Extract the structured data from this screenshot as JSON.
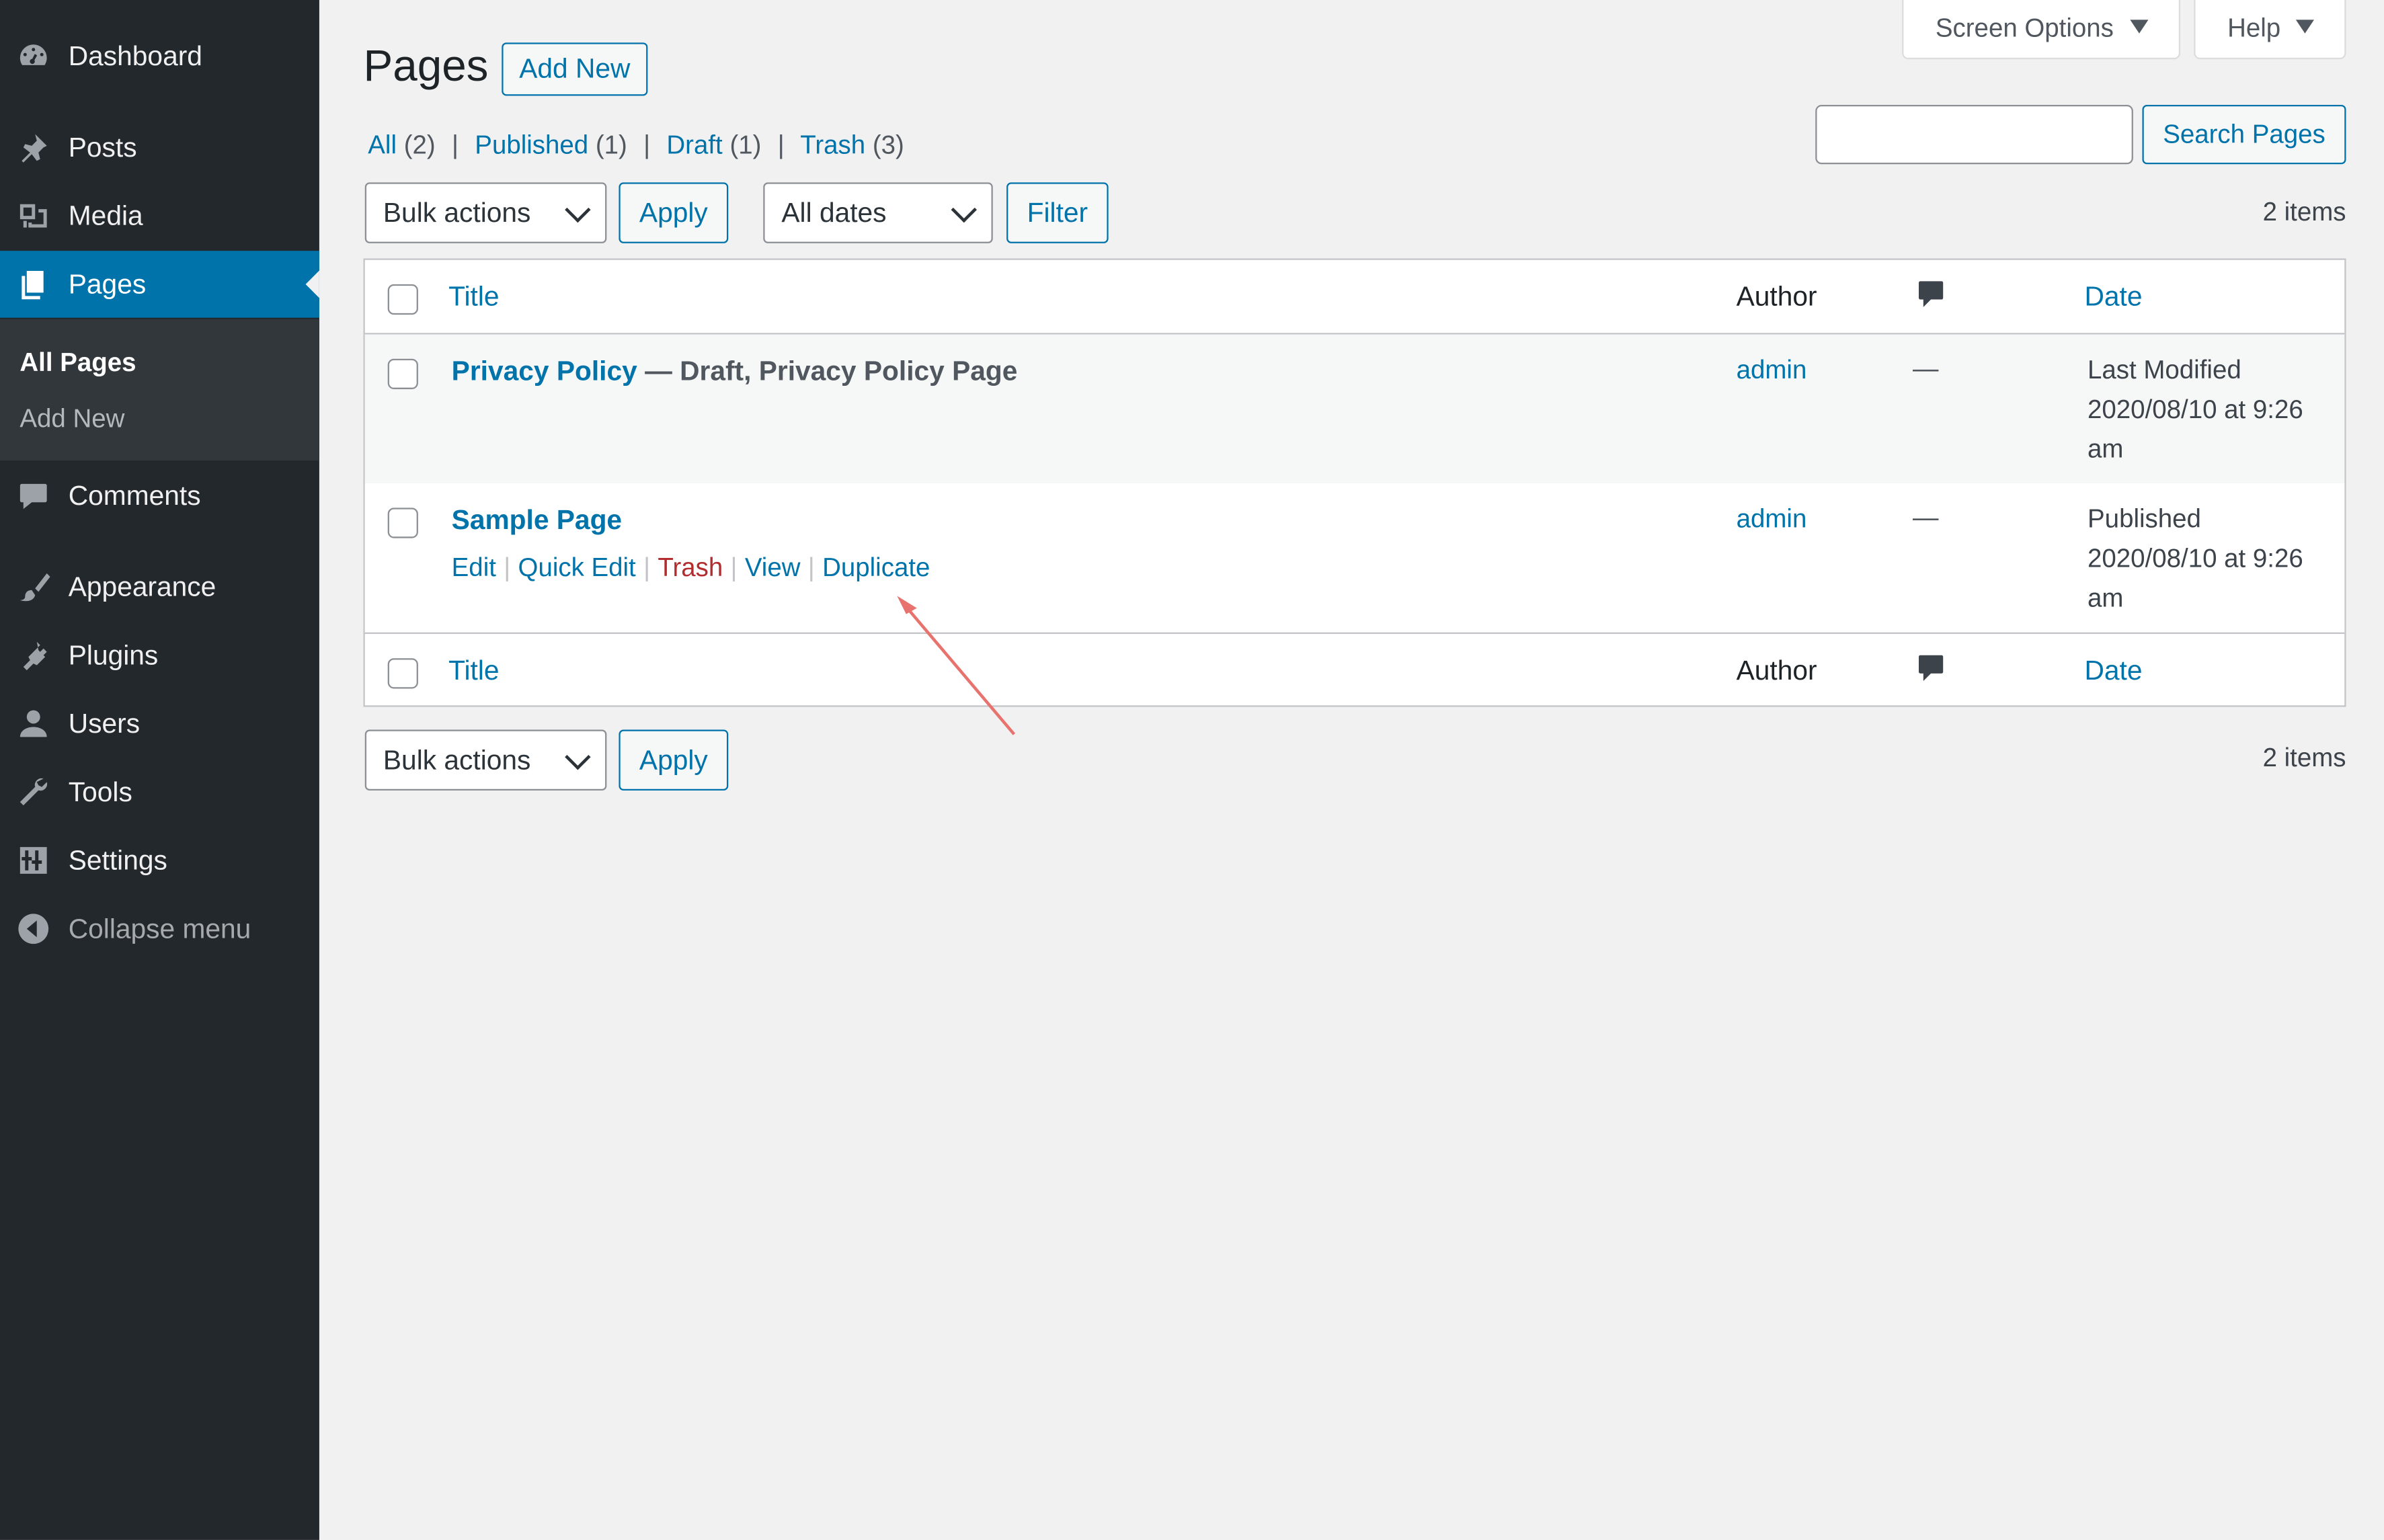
{
  "sidebar": {
    "items": [
      {
        "id": "dashboard",
        "label": "Dashboard",
        "icon": "dashboard-icon"
      },
      {
        "id": "posts",
        "label": "Posts",
        "icon": "pushpin-icon"
      },
      {
        "id": "media",
        "label": "Media",
        "icon": "media-icon"
      },
      {
        "id": "pages",
        "label": "Pages",
        "icon": "pages-icon"
      },
      {
        "id": "comments",
        "label": "Comments",
        "icon": "comment-icon"
      },
      {
        "id": "appearance",
        "label": "Appearance",
        "icon": "paintbrush-icon"
      },
      {
        "id": "plugins",
        "label": "Plugins",
        "icon": "plugin-icon"
      },
      {
        "id": "users",
        "label": "Users",
        "icon": "user-icon"
      },
      {
        "id": "tools",
        "label": "Tools",
        "icon": "wrench-icon"
      },
      {
        "id": "settings",
        "label": "Settings",
        "icon": "sliders-icon"
      },
      {
        "id": "collapse",
        "label": "Collapse menu",
        "icon": "collapse-arrow-icon"
      }
    ],
    "submenu": [
      {
        "label": "All Pages",
        "active": true
      },
      {
        "label": "Add New",
        "active": false
      }
    ]
  },
  "header": {
    "title": "Pages",
    "add_new": "Add New",
    "screen_options": "Screen Options",
    "help": "Help"
  },
  "views": [
    {
      "label": "All",
      "count": "(2)"
    },
    {
      "label": "Published",
      "count": "(1)"
    },
    {
      "label": "Draft",
      "count": "(1)"
    },
    {
      "label": "Trash",
      "count": "(3)"
    }
  ],
  "search": {
    "value": "",
    "button": "Search Pages"
  },
  "tablenav_top": {
    "bulk_actions": "Bulk actions",
    "apply": "Apply",
    "dates": "All dates",
    "filter": "Filter",
    "count": "2 items"
  },
  "tablenav_bottom": {
    "bulk_actions": "Bulk actions",
    "apply": "Apply",
    "count": "2 items"
  },
  "columns": {
    "title": "Title",
    "author": "Author",
    "comments_icon": "comment-bubble-icon",
    "date": "Date"
  },
  "rows": [
    {
      "title": "Privacy Policy",
      "state": " — Draft, Privacy Policy Page",
      "author": "admin",
      "comments": "—",
      "date_status": "Last Modified",
      "date_value": "2020/08/10 at 9:26",
      "date_suffix": "am"
    },
    {
      "title": "Sample Page",
      "state": "",
      "author": "admin",
      "comments": "—",
      "date_status": "Published",
      "date_value": "2020/08/10 at 9:26",
      "date_suffix": "am",
      "actions": {
        "edit": "Edit",
        "quick_edit": "Quick Edit",
        "trash": "Trash",
        "view": "View",
        "duplicate": "Duplicate"
      }
    }
  ],
  "colors": {
    "sidebar_bg": "#23282d",
    "accent": "#0073aa",
    "trash_red": "#b32d2e",
    "annotation_arrow": "#e8736e"
  }
}
